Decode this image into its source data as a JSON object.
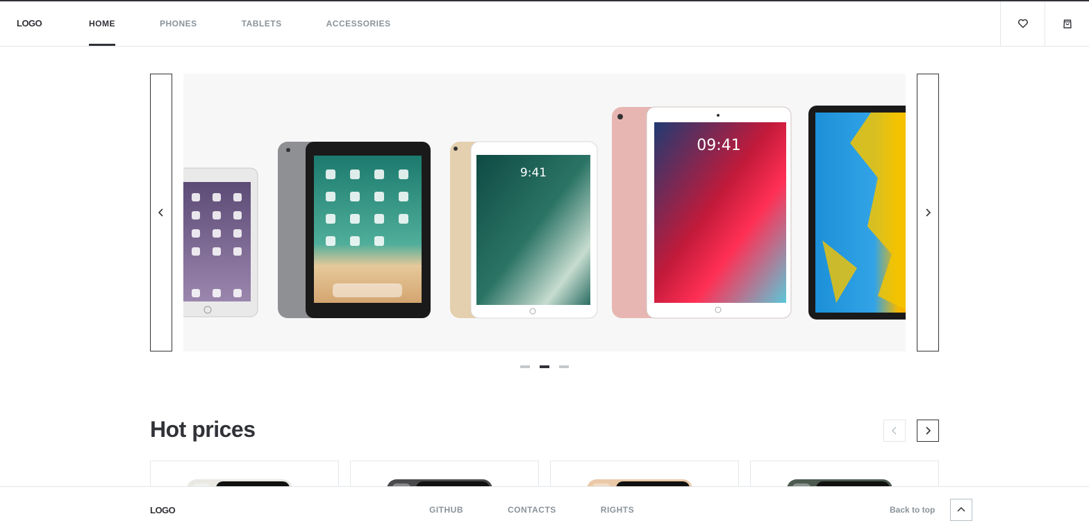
{
  "header": {
    "logo": "LOGO",
    "nav": [
      {
        "label": "HOME",
        "active": true
      },
      {
        "label": "PHONES",
        "active": false
      },
      {
        "label": "TABLETS",
        "active": false
      },
      {
        "label": "ACCESSORIES",
        "active": false
      }
    ],
    "icons": [
      "heart-icon",
      "shopping-bag-icon"
    ]
  },
  "banner": {
    "icons": [
      "chevron-left-icon",
      "chevron-right-icon"
    ],
    "tablets": [
      {
        "color": "silver",
        "screen_time": ""
      },
      {
        "color": "space-gray",
        "screen_time": ""
      },
      {
        "color": "gold",
        "screen_time": "9:41"
      },
      {
        "color": "rose-gold",
        "screen_time": "09:41"
      },
      {
        "color": "black",
        "screen_time": ""
      }
    ],
    "slides_total": 3,
    "active_slide_number": 2
  },
  "hot_prices": {
    "title": "Hot prices",
    "cards": [
      {
        "phone_color": "silver"
      },
      {
        "phone_color": "space-gray"
      },
      {
        "phone_color": "gold"
      },
      {
        "phone_color": "midnight-green"
      }
    ]
  },
  "footer": {
    "logo": "LOGO",
    "links": [
      "GITHUB",
      "CONTACTS",
      "RIGHTS"
    ],
    "back_to_top": "Back to top"
  },
  "colors": {
    "primary": "#313237",
    "secondary": "#89939a",
    "border": "#e2e6e9",
    "banner_bg": "#f7f7f7"
  }
}
